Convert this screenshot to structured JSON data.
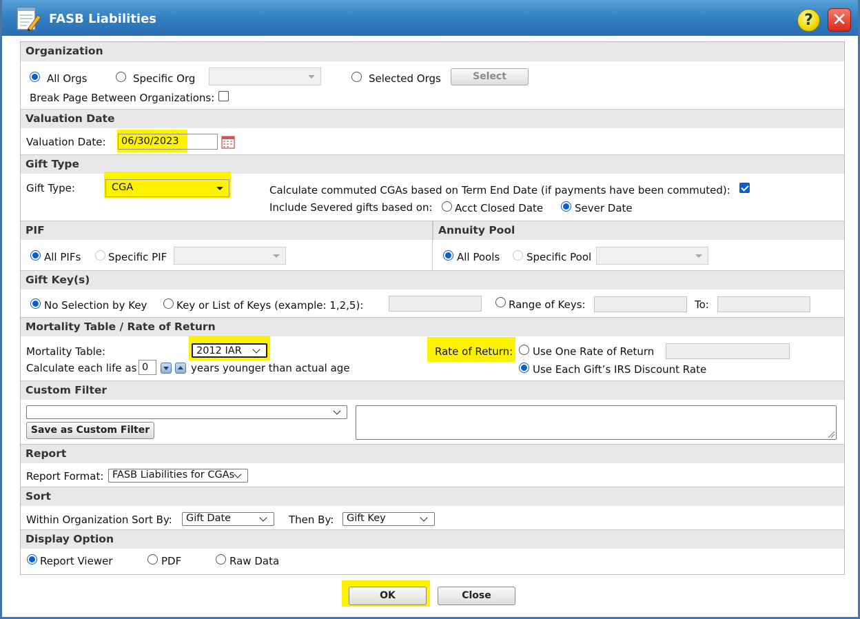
{
  "window": {
    "title": "FASB Liabilities",
    "help_glyph": "?",
    "close_glyph": "✕"
  },
  "organization": {
    "header": "Organization",
    "all_orgs": "All Orgs",
    "specific_org": "Specific Org",
    "selected_orgs": "Selected Orgs",
    "select_button": "Select",
    "break_page": "Break Page Between Organizations:"
  },
  "valuation": {
    "header": "Valuation Date",
    "label": "Valuation Date:",
    "value": "06/30/2023"
  },
  "gift_type": {
    "header": "Gift Type",
    "label": "Gift Type:",
    "value": "CGA",
    "commuted_label": "Calculate commuted CGAs based on Term End Date (if payments have been commuted):",
    "severed_label": "Include Severed gifts based on:",
    "acct_closed": "Acct Closed Date",
    "sever_date": "Sever Date"
  },
  "pif": {
    "header": "PIF",
    "all": "All PIFs",
    "specific": "Specific PIF"
  },
  "pool": {
    "header": "Annuity Pool",
    "all": "All Pools",
    "specific": "Specific Pool"
  },
  "gift_keys": {
    "header": "Gift Key(s)",
    "no_selection": "No Selection by Key",
    "key_list": "Key or List of Keys (example: 1,2,5):",
    "range": "Range of Keys:",
    "to": "To:"
  },
  "mortality": {
    "header": "Mortality Table / Rate of Return",
    "table_label": "Mortality Table:",
    "table_value": "2012 IAR",
    "calc_prefix": "Calculate each life as",
    "years_value": "0",
    "calc_suffix": "years younger than actual age",
    "rate_label": "Rate of Return:",
    "one_rate": "Use One Rate of Return",
    "each_gift": "Use Each Gift’s IRS Discount Rate"
  },
  "custom_filter": {
    "header": "Custom Filter",
    "save_button": "Save as Custom Filter"
  },
  "report": {
    "header": "Report",
    "format_label": "Report Format:",
    "format_value": "FASB Liabilities for CGAs"
  },
  "sort": {
    "header": "Sort",
    "within_label": "Within Organization Sort By:",
    "within_value": "Gift Date",
    "then_label": "Then By:",
    "then_value": "Gift Key"
  },
  "display": {
    "header": "Display Option",
    "viewer": "Report Viewer",
    "pdf": "PDF",
    "raw": "Raw Data"
  },
  "footer": {
    "ok": "OK",
    "close": "Close"
  },
  "colors": {
    "titlebar": "#2f7cc0",
    "highlight": "#fff200",
    "radio_accent": "#0a5fcf"
  }
}
